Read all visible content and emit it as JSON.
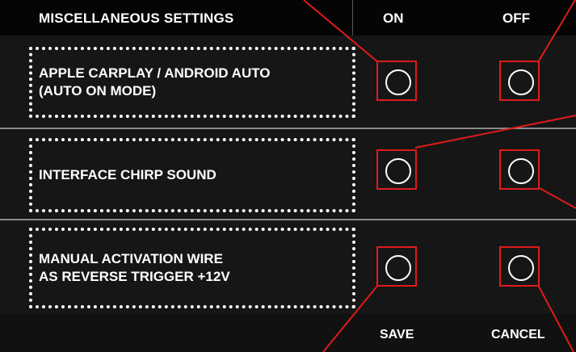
{
  "header": {
    "title": "MISCELLANEOUS SETTINGS",
    "on_label": "ON",
    "off_label": "OFF"
  },
  "settings": [
    {
      "lines": [
        "APPLE CARPLAY / ANDROID AUTO",
        "(AUTO ON MODE)"
      ]
    },
    {
      "lines": [
        "INTERFACE CHIRP SOUND"
      ]
    },
    {
      "lines": [
        "MANUAL ACTIVATION WIRE",
        "AS REVERSE TRIGGER +12V"
      ]
    }
  ],
  "footer": {
    "save_label": "SAVE",
    "cancel_label": "CANCEL"
  },
  "colors": {
    "background": "#161616",
    "header_bg": "#050505",
    "highlight": "#e01b1b",
    "text": "#ffffff"
  }
}
